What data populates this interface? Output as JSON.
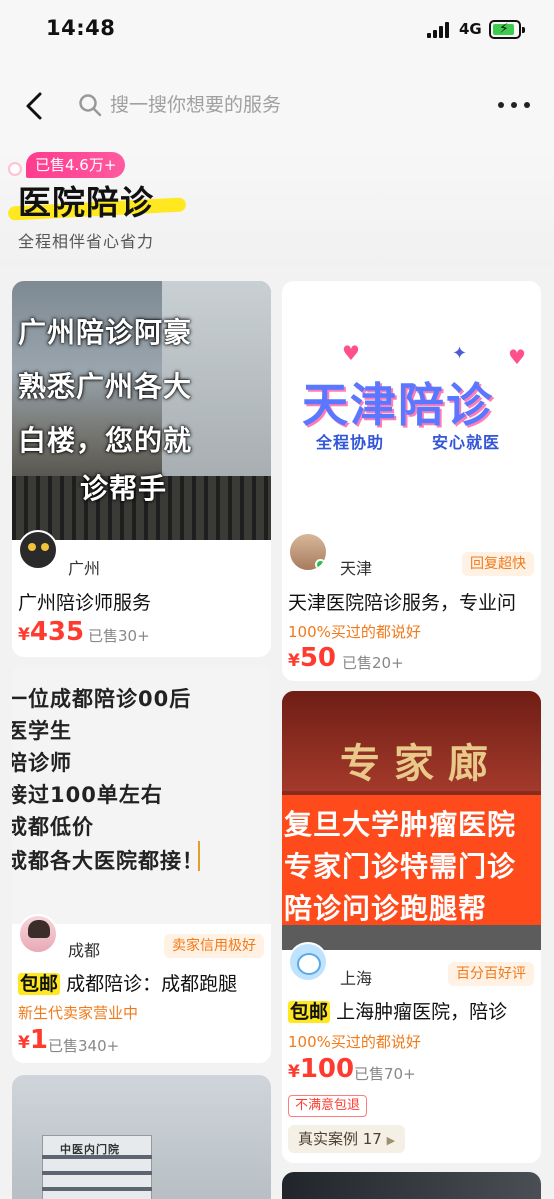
{
  "status_bar": {
    "time": "14:48",
    "network": "4G"
  },
  "search": {
    "placeholder": "搜一搜你想要的服务"
  },
  "header": {
    "badge": "已售4.6万+",
    "title": "医院陪诊",
    "subtitle": "全程相伴省心省力"
  },
  "cards": [
    {
      "image_text": [
        "广州陪诊阿豪",
        "熟悉广州各大",
        "白楼，您的就",
        "诊帮手"
      ],
      "city": "广州",
      "title": "广州陪诊师服务",
      "currency": "¥",
      "price": "435",
      "sold": "已售30+"
    },
    {
      "image_text": {
        "main": "天津陪诊",
        "left": "全程协助",
        "right": "安心就医"
      },
      "city": "天津",
      "tag": "回复超快",
      "title": "天津医院陪诊服务，专业问",
      "note": "100%买过的都说好",
      "currency": "¥",
      "price": "50",
      "sold": "已售20+"
    },
    {
      "image_text": [
        "一位成都陪诊00后",
        "医学生",
        "陪诊师",
        "接过100单左右",
        "成都低价",
        "成都各大医院都接！"
      ],
      "city": "成都",
      "tag": "卖家信用极好",
      "free": "包邮",
      "title": "成都陪诊：成都跑腿",
      "note": "新生代卖家营业中",
      "currency": "¥",
      "price": "1",
      "sold": "已售340+"
    },
    {
      "image_text": {
        "sign": "专家廊",
        "lines": [
          "复旦大学肿瘤医院",
          "专家门诊特需门诊",
          "陪诊问诊跑腿帮"
        ]
      },
      "city": "上海",
      "tag": "百分百好评",
      "free": "包邮",
      "title": "上海肿瘤医院，陪诊",
      "note": "100%买过的都说好",
      "currency": "¥",
      "price": "100",
      "sold": "已售70+",
      "guarantee": "不满意包退",
      "cases": "真实案例 17"
    },
    {
      "image_text": {
        "sign": "中医内门院"
      }
    }
  ]
}
